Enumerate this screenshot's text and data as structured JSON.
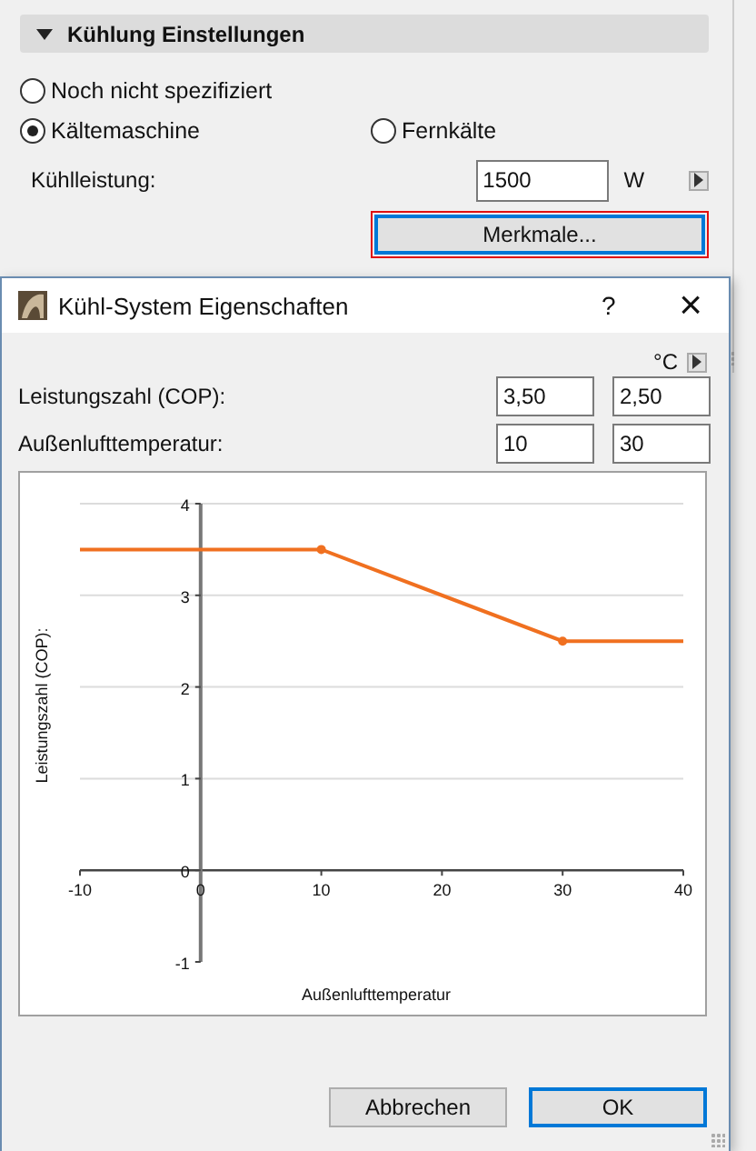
{
  "section": {
    "title": "Kühlung Einstellungen",
    "expanded": true
  },
  "source_options": [
    {
      "label": "Noch nicht spezifiziert",
      "selected": false
    },
    {
      "label": "Kältemaschine",
      "selected": true
    },
    {
      "label": "Fernkälte",
      "selected": false
    }
  ],
  "cooling_capacity": {
    "label": "Kühlleistung:",
    "value": "1500",
    "unit": "W"
  },
  "properties_button": {
    "label": "Merkmale...",
    "highlighted": true
  },
  "dialog": {
    "title": "Kühl-System Eigenschaften",
    "help": "?",
    "close": "×",
    "unit": "°C",
    "rows": [
      {
        "label": "Leistungszahl (COP):",
        "values": [
          "3,50",
          "2,50"
        ]
      },
      {
        "label": "Außenlufttemperatur:",
        "values": [
          "10",
          "30"
        ]
      }
    ],
    "chart_data": {
      "type": "line",
      "xlabel": "Außenlufttemperatur",
      "ylabel": "Leistungszahl (COP):",
      "x": [
        -10,
        10,
        30,
        40
      ],
      "series": [
        {
          "color": "#f07020",
          "values": [
            3.5,
            3.5,
            2.5,
            2.5
          ]
        }
      ],
      "grid": true,
      "xlim": [
        -10,
        40
      ],
      "ylim": [
        -1,
        4
      ],
      "xticks": [
        -10,
        0,
        10,
        20,
        30,
        40
      ],
      "yticks": [
        -1,
        0,
        1,
        2,
        3,
        4
      ]
    },
    "buttons": [
      {
        "label": "Abbrechen",
        "selected": false
      },
      {
        "label": "OK",
        "selected": true
      }
    ]
  }
}
